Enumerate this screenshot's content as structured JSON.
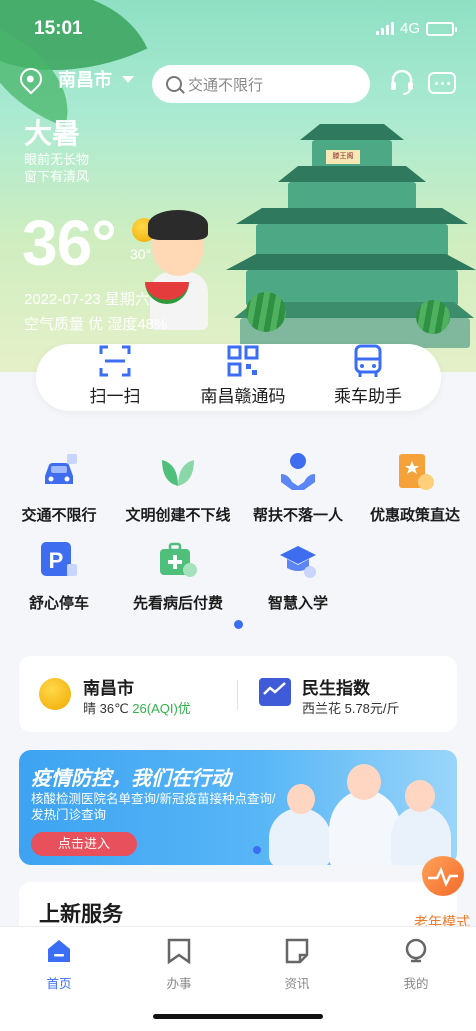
{
  "status_bar": {
    "time": "15:01",
    "network": "4G"
  },
  "header": {
    "city": "南昌市",
    "search_placeholder": "交通不限行"
  },
  "weather_hero": {
    "solar_term": "大暑",
    "poem_line1": "眼前无长物",
    "poem_line2": "窗下有清风",
    "temperature": "36°",
    "condition": "晴",
    "low_temp": "30°",
    "date": "2022-07-23  星期六",
    "air_quality": "空气质量 优  湿度48%",
    "pagoda_sign": "滕王阁"
  },
  "quick_actions": [
    {
      "label": "扫一扫",
      "icon": "scan-icon"
    },
    {
      "label": "南昌赣通码",
      "icon": "qr-code-icon"
    },
    {
      "label": "乘车助手",
      "icon": "bus-icon"
    }
  ],
  "services": [
    {
      "label": "交通不限行",
      "icon": "car-icon",
      "color": "#3f6df0"
    },
    {
      "label": "文明创建不下线",
      "icon": "leaves-icon",
      "color": "#4fbf7c"
    },
    {
      "label": "帮扶不落一人",
      "icon": "helping-hands-icon",
      "color": "#3f6df0"
    },
    {
      "label": "优惠政策直达",
      "icon": "policy-badge-icon",
      "color": "#f5a23a"
    },
    {
      "label": "舒心停车",
      "icon": "parking-icon",
      "color": "#3f6df0"
    },
    {
      "label": "先看病后付费",
      "icon": "medical-kit-icon",
      "color": "#4fbf7c"
    },
    {
      "label": "智慧入学",
      "icon": "graduation-cap-icon",
      "color": "#3f6df0"
    }
  ],
  "weather_card": {
    "city": "南昌市",
    "detail_prefix": "晴 36℃ ",
    "aqi": "26(AQI)优",
    "index_title": "民生指数",
    "index_detail": "西兰花 5.78元/斤"
  },
  "banner": {
    "title": "疫情防控，我们在行动",
    "description": "核酸检测医院名单查询/新冠疫苗接种点查询/发热门诊查询",
    "button": "点击进入"
  },
  "new_services": {
    "title": "上新服务"
  },
  "elder_mode": {
    "label": "老年模式"
  },
  "tabbar": [
    {
      "label": "首页",
      "icon": "home-icon",
      "active": true
    },
    {
      "label": "办事",
      "icon": "bookmark-icon",
      "active": false
    },
    {
      "label": "资讯",
      "icon": "news-icon",
      "active": false
    },
    {
      "label": "我的",
      "icon": "profile-icon",
      "active": false
    }
  ],
  "colors": {
    "accent": "#3b6ef5",
    "hero_green": "#8fe0c4",
    "aqi_green": "#2fb24a"
  }
}
